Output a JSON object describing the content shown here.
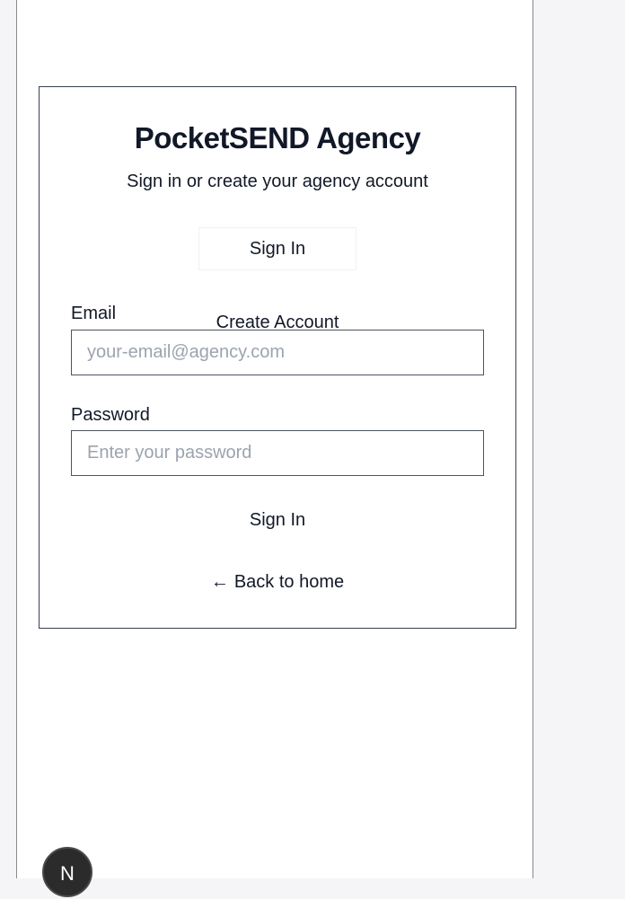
{
  "app": {
    "title": "PocketSEND Agency",
    "subtitle": "Sign in or create your agency account"
  },
  "tabs": [
    {
      "label": "Sign In",
      "active": true
    },
    {
      "label": "Create Account",
      "active": false
    }
  ],
  "form": {
    "email": {
      "label": "Email",
      "value": "",
      "placeholder": "your-email@agency.com"
    },
    "password": {
      "label": "Password",
      "value": "",
      "placeholder": "Enter your password"
    },
    "submit_label": "Sign In"
  },
  "back_link": {
    "arrow": "←",
    "label": "Back to home"
  },
  "dev_badge": {
    "letter": "N"
  },
  "colors": {
    "text": "#111827",
    "border": "#374151",
    "placeholder": "#9ca3af",
    "badge": "#2b2b2b"
  }
}
